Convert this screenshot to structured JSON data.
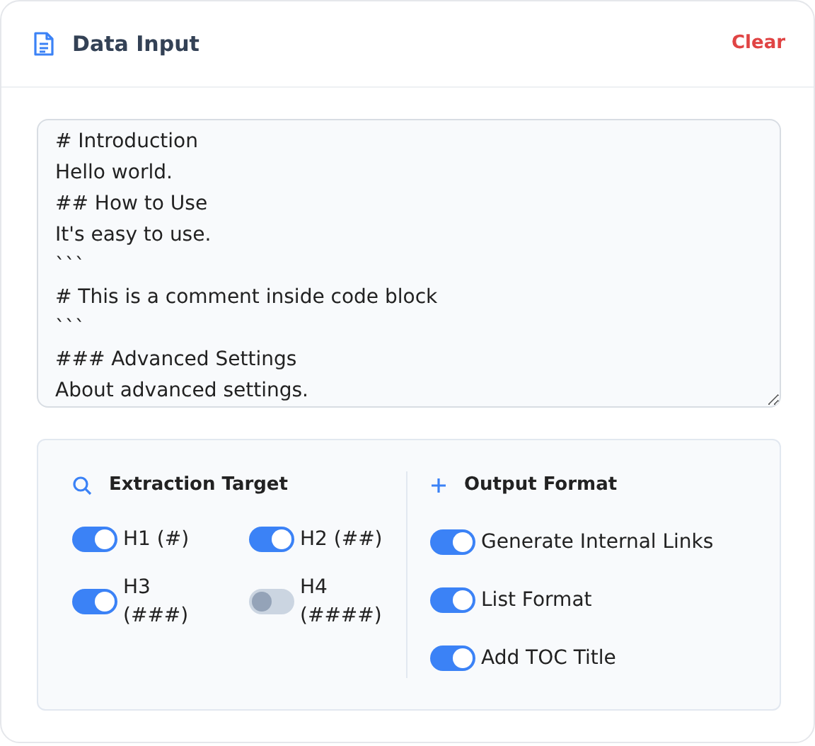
{
  "header": {
    "title": "Data Input",
    "clear_label": "Clear"
  },
  "editor": {
    "lines": [
      "# Introduction",
      "Hello world.",
      "## How to Use",
      "It's easy to use.",
      "```",
      "# This is a comment inside code block",
      "```",
      "### Advanced Settings",
      "About advanced settings."
    ]
  },
  "extraction_target": {
    "title": "Extraction Target",
    "options": [
      {
        "label": "H1 (#)",
        "on": true
      },
      {
        "label": "H2 (##)",
        "on": true
      },
      {
        "label": "H3 (###)",
        "on": true
      },
      {
        "label": "H4 (####)",
        "on": false
      }
    ]
  },
  "output_format": {
    "title": "Output Format",
    "options": [
      {
        "label": "Generate Internal Links",
        "on": true
      },
      {
        "label": "List Format",
        "on": true
      },
      {
        "label": "Add TOC Title",
        "on": true
      }
    ]
  }
}
